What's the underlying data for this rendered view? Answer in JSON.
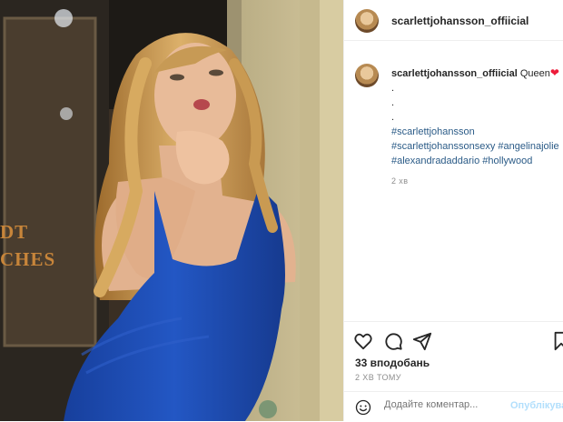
{
  "post": {
    "username": "scarlettjohansson_offiicial",
    "caption": {
      "text": "Queen",
      "heart": "❤",
      "dots": [
        ".",
        ".",
        "."
      ],
      "hashtags_lines": [
        "#scarlettjohansson",
        "#scarlettjohanssonsexy #angelinajolie",
        "#alexandradaddario #hollywood"
      ],
      "time": "2 хв"
    },
    "likes": "33 вподобань",
    "time_ago": "2 ХВ ТОМУ",
    "comment": {
      "placeholder": "Додайте коментар...",
      "publish_label": "Опублікувати"
    },
    "photo": {
      "sign_lines": [
        "DT",
        "CHES"
      ]
    },
    "icons": [
      "heart-icon",
      "comment-icon",
      "share-icon",
      "save-icon",
      "emoji-icon"
    ],
    "colors": {
      "hashtag": "#2b5b87",
      "heart": "#ed1c3a",
      "publish_disabled": "#b2dffc",
      "dress": "#1f4fb5"
    }
  }
}
